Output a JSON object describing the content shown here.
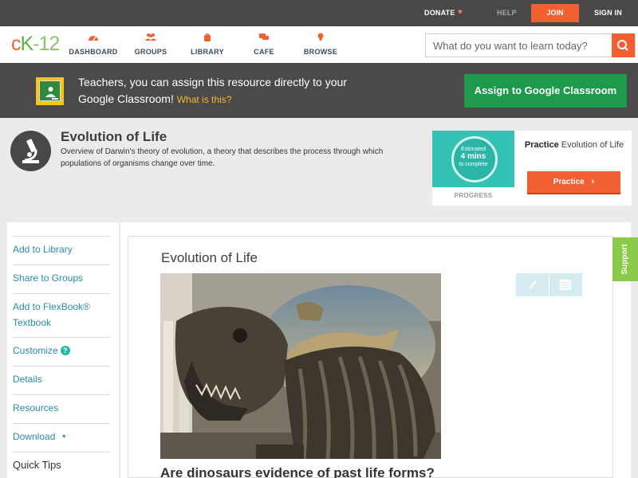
{
  "topbar": {
    "donate": "DONATE",
    "help": "HELP",
    "join": "JOIN",
    "signin": "SIGN IN"
  },
  "brand": {
    "logo_c": "c",
    "logo_k": "K",
    "logo_num": "-12"
  },
  "nav": {
    "items": [
      {
        "label": "DASHBOARD",
        "icon": "dashboard-gauge-icon"
      },
      {
        "label": "GROUPS",
        "icon": "groups-people-icon"
      },
      {
        "label": "LIBRARY",
        "icon": "library-bag-icon"
      },
      {
        "label": "CAFE",
        "icon": "cafe-chat-icon"
      },
      {
        "label": "BROWSE",
        "icon": "browse-bulb-icon"
      }
    ],
    "search_placeholder": "What do you want to learn today?"
  },
  "classroom": {
    "text": "Teachers, you can assign this resource directly to your Google Classroom!",
    "what": "What is this?",
    "button": "Assign to Google Classroom"
  },
  "concept": {
    "title": "Evolution of Life",
    "description": "Overview of Darwin's theory of evolution, a theory that describes the process through which populations of organisms change over time."
  },
  "practice_card": {
    "estimated": "Estimated",
    "mins": "4 mins",
    "to_complete": "to complete",
    "progress_label": "PROGRESS",
    "practice_word": "Practice",
    "practice_rest": "Evolution of Life",
    "button": "Practice"
  },
  "sidebar": {
    "items": [
      "Add to Library",
      "Share to Groups",
      "Add to FlexBook® Textbook",
      "Customize",
      "Details",
      "Resources",
      "Download",
      "Quick Tips"
    ],
    "customize_help": "?",
    "download_caret": "▼"
  },
  "content": {
    "title": "Evolution of Life",
    "question": "Are dinosaurs evidence of past life forms?"
  },
  "support": "Support",
  "colors": {
    "brand_orange": "#f26031",
    "classroom_green": "#1e9a4c",
    "teal": "#33c2b3",
    "link_blue": "#2a8ba8",
    "support_green": "#8bc94a"
  }
}
